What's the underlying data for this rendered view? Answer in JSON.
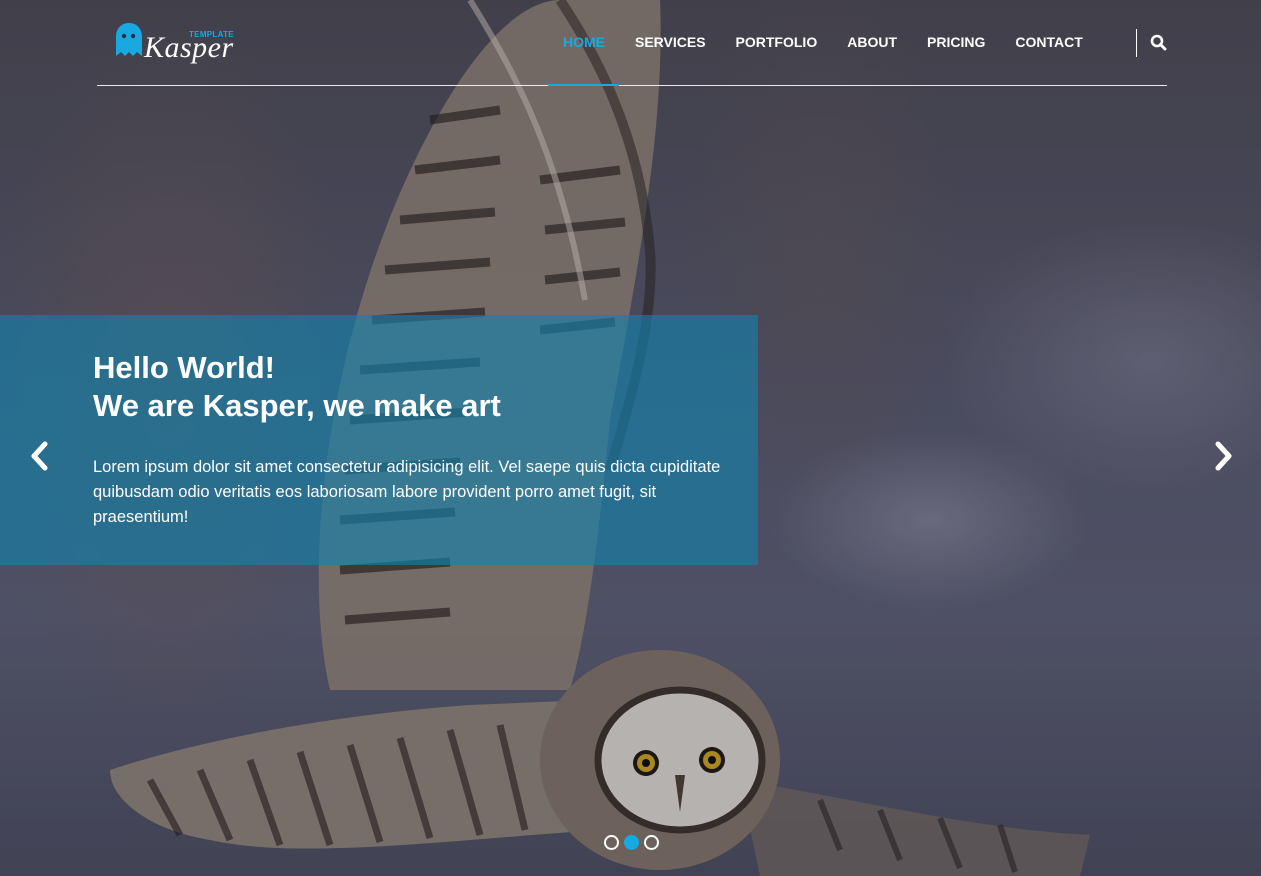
{
  "logo": {
    "tagline": "TEMPLATE",
    "name": "Kasper",
    "icon": "ghost-icon"
  },
  "nav": {
    "items": [
      {
        "label": "HOME",
        "active": true
      },
      {
        "label": "SERVICES",
        "active": false
      },
      {
        "label": "PORTFOLIO",
        "active": false
      },
      {
        "label": "ABOUT",
        "active": false
      },
      {
        "label": "PRICING",
        "active": false
      },
      {
        "label": "CONTACT",
        "active": false
      }
    ],
    "search_icon": "search-icon"
  },
  "hero": {
    "heading_line1": "Hello World!",
    "heading_line2": "We are Kasper, we make art",
    "text": "Lorem ipsum dolor sit amet consectetur adipisicing elit. Vel saepe quis dicta cupiditate quibusdam odio veritatis eos laboriosam labore provident porro amet fugit, sit praesentium!",
    "prev_icon": "chevron-left-icon",
    "next_icon": "chevron-right-icon"
  },
  "slider": {
    "slide_count": 3,
    "active_index": 1
  },
  "colors": {
    "accent": "#19a9e1",
    "caption_bg": "rgba(18,130,175,0.62)",
    "text": "#ffffff"
  }
}
